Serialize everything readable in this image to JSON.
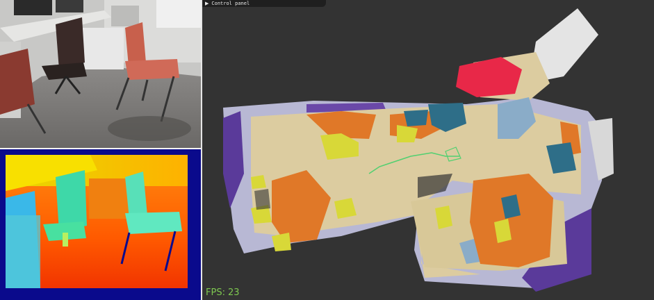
{
  "control_panel": {
    "label": "Control panel",
    "arrow_icon": "triangle-right-icon"
  },
  "fps": {
    "label": "FPS:",
    "value": "23"
  },
  "colors": {
    "viewport_background": "#333333",
    "fps_text": "#7ec850",
    "floor": "#dccca0",
    "orange_segment": "#e07828",
    "yellow_segment": "#d8d838",
    "blue_segment": "#2e6e88",
    "red_segment": "#e82848",
    "purple_segment": "#5a3a9a"
  }
}
